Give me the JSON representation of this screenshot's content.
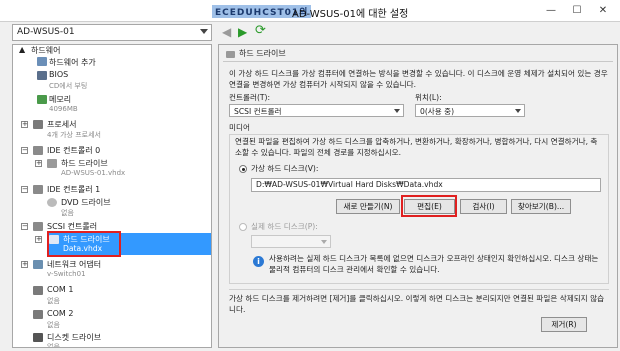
{
  "window": {
    "logo_text": "ECEDUHCST01의",
    "title": "AD-WSUS-01에 대한 설정",
    "min_icon": "minimize-icon",
    "max_icon": "maximize-icon",
    "close_icon": "close-icon"
  },
  "toolbar": {
    "vm_name": "AD-WSUS-01",
    "back_icon": "back-icon",
    "forward_icon": "forward-icon",
    "refresh_icon": "refresh-icon",
    "back_glyph": "◀",
    "forward_glyph": "▶",
    "refresh_glyph": "⟳"
  },
  "tree": {
    "hardware_header": "하드웨어",
    "add_hardware": "하드웨어 추가",
    "bios": "BIOS",
    "bios_sub": "CD에서 부팅",
    "memory": "메모리",
    "memory_sub": "4096MB",
    "processor": "프로세서",
    "processor_sub": "4개 가상 프로세서",
    "ide0": "IDE 컨트롤러 0",
    "ide0_drive": "하드 드라이브",
    "ide0_drive_sub": "AD-WSUS-01.vhdx",
    "ide1": "IDE 컨트롤러 1",
    "ide1_dvd": "DVD 드라이브",
    "ide1_dvd_sub": "없음",
    "scsi": "SCSI 컨트롤러",
    "scsi_drive": "하드 드라이브",
    "scsi_drive_sub": "Data.vhdx",
    "network": "네트워크 어댑터",
    "network_sub": "v-Switch01",
    "com1": "COM 1",
    "com1_sub": "없음",
    "com2": "COM 2",
    "com2_sub": "없음",
    "diskette": "디스켓 드라이브",
    "diskette_sub": "없음"
  },
  "panel": {
    "section_title": "하드 드라이브",
    "intro": "이 가상 하드 디스크를 가상 컴퓨터에 연결하는 방식을 변경할 수 있습니다. 이 디스크에 운영 체제가 설치되어 있는 경우 연결을 변경하면 가상 컴퓨터가 시작되지 않을 수 있습니다.",
    "controller_label": "컨트롤러(T):",
    "controller_value": "SCSI 컨트롤러",
    "location_label": "위치(L):",
    "location_value": "0(사용 중)",
    "media_label": "미디어",
    "media_desc": "연결된 파일을 편집하여 가상 하드 디스크를 압축하거나, 변환하거나, 확장하거나, 병합하거나, 다시 연결하거나, 축소할 수 있습니다. 파일의 전체 경로를 지정하십시오.",
    "vhd_option": "가상 하드 디스크(V):",
    "vhd_path": "D:₩AD-WSUS-01₩Virtual Hard Disks₩Data.vhdx",
    "btn_new": "새로 만들기(N)",
    "btn_edit": "편집(E)",
    "btn_inspect": "검사(I)",
    "btn_browse": "찾아보기(B)...",
    "physical_option": "실제 하드 디스크(P):",
    "physical_note": "사용하려는 실제 하드 디스크가 목록에 없으면 디스크가 오프라인 상태인지 확인하십시오. 디스크 상태는 물리적 컴퓨터의 디스크 관리에서 확인할 수 있습니다.",
    "remove_text": "가상 하드 디스크를 제거하려면 [제거]를 클릭하십시오. 이렇게 하면 디스크는 분리되지만 연결된 파일은 삭제되지 않습니다.",
    "btn_remove": "제거(R)"
  },
  "colors": {
    "selection": "#3399ff",
    "highlight_box": "#e02020"
  }
}
